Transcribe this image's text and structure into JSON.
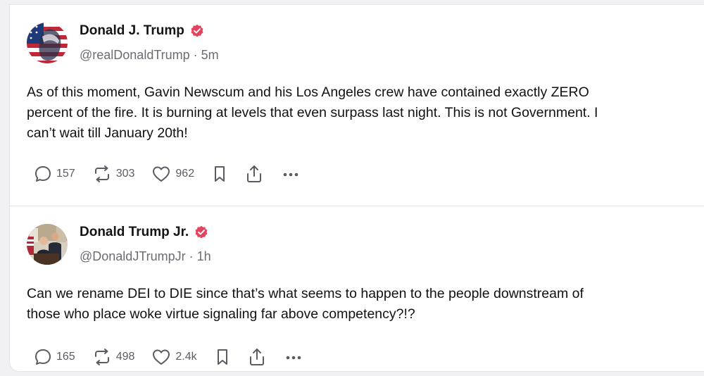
{
  "posts": [
    {
      "author": "Donald J. Trump",
      "handle": "@realDonaldTrump",
      "separator": " · ",
      "time": "5m",
      "lines": [
        "As of this moment, Gavin Newscum and his Los Angeles crew have contained exactly ZERO",
        "percent of the fire. It is burning at levels that even surpass last night. This is not Government. I",
        "can’t wait till January 20th!"
      ],
      "replies": "157",
      "reposts": "303",
      "likes": "962"
    },
    {
      "author": "Donald Trump Jr.",
      "handle": "@DonaldJTrumpJr",
      "separator": " · ",
      "time": "1h",
      "lines": [
        "Can we rename DEI to DIE since that’s what seems to happen to the people downstream of",
        "those who place woke virtue signaling far above competency?!?"
      ],
      "replies": "165",
      "reposts": "498",
      "likes": "2.4k"
    }
  ],
  "icons": {
    "verified": "verified-badge-icon",
    "reply": "reply-icon",
    "repost": "repost-icon",
    "like": "heart-icon",
    "bookmark": "bookmark-icon",
    "share": "share-icon",
    "more": "more-icon"
  },
  "colors": {
    "verified_badge": "#e0445e",
    "muted_text": "#6b6b73",
    "icon": "#5b5b63"
  }
}
